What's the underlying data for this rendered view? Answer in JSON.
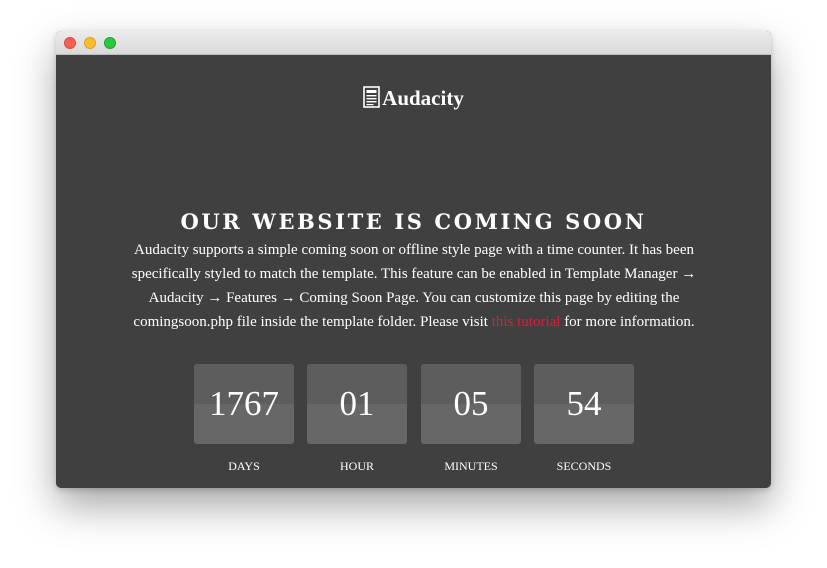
{
  "window": {
    "controls": [
      "close-button",
      "minimize-button",
      "zoom-button"
    ]
  },
  "logo": {
    "icon": "newspaper-icon",
    "text": "Audacity"
  },
  "headline": "OUR WEBSITE IS COMING SOON",
  "description": {
    "before_link": "Audacity supports a simple coming soon or offline style page with a time counter. It has been specifically styled to match the template. This feature can be enabled in Template Manager → Audacity → Features → Coming Soon Page. You can customize this page by editing the comingsoon.php file inside the template folder. Please visit ",
    "link_text": "this tutorial",
    "after_link": " for more information."
  },
  "countdown": [
    {
      "value": "1767",
      "label": "DAYS"
    },
    {
      "value": "01",
      "label": "HOUR"
    },
    {
      "value": "05",
      "label": "MINUTES"
    },
    {
      "value": "54",
      "label": "SECONDS"
    }
  ],
  "colors": {
    "background": "#404040",
    "counter_box": "#676767",
    "link": "#d81f3e",
    "text": "#ffffff"
  }
}
